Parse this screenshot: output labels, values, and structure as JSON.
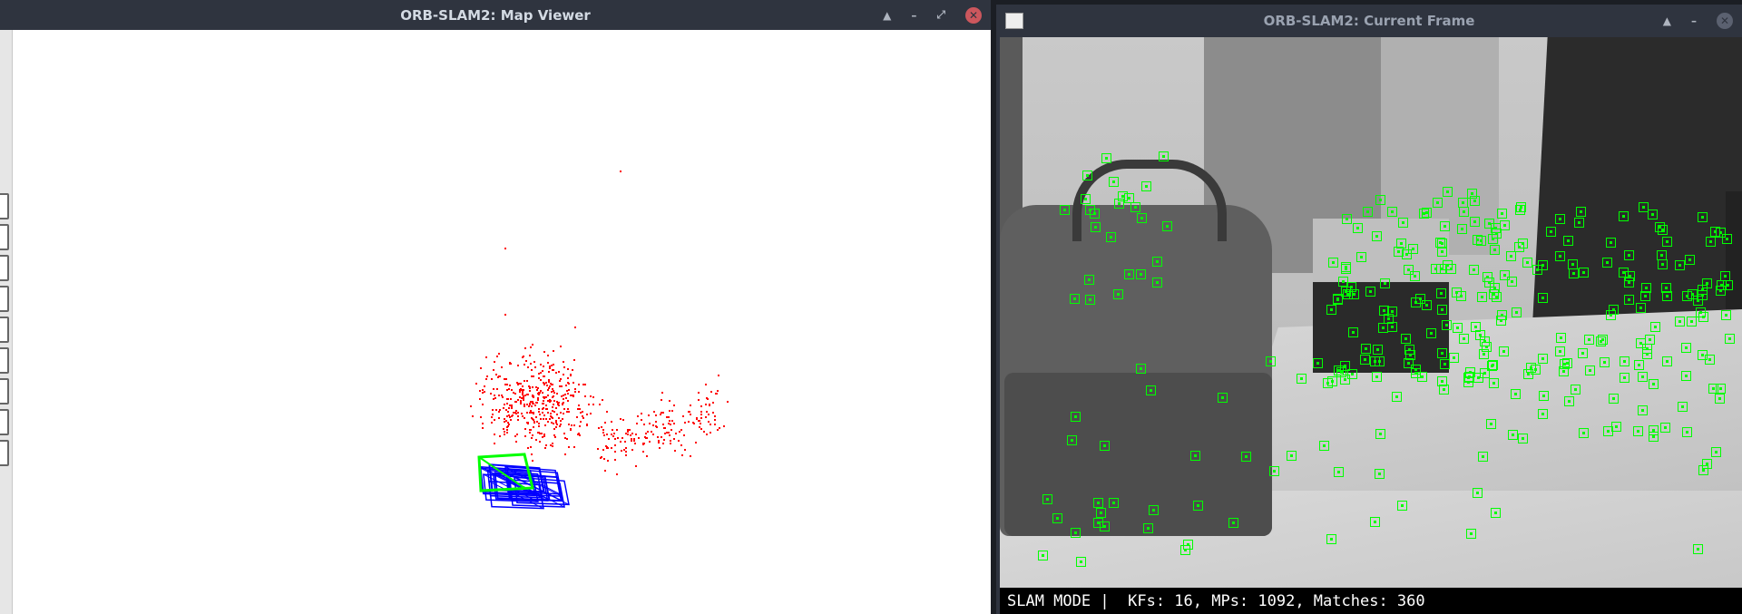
{
  "map_viewer": {
    "title": "ORB-SLAM2: Map Viewer",
    "menu_checkbox_count": 9
  },
  "current_frame": {
    "title": "ORB-SLAM2: Current Frame"
  },
  "status": {
    "mode": "SLAM MODE",
    "separator": "|",
    "text": "KFs: 16, MPs: 1092, Matches: 360",
    "keyframes": 16,
    "map_points": 1092,
    "matches": 360
  },
  "colors": {
    "map_points": "#ff0000",
    "keyframes": "#0000ff",
    "current_camera": "#00ff00",
    "keypoints": "#00ff00",
    "titlebar": "#2f343f"
  }
}
